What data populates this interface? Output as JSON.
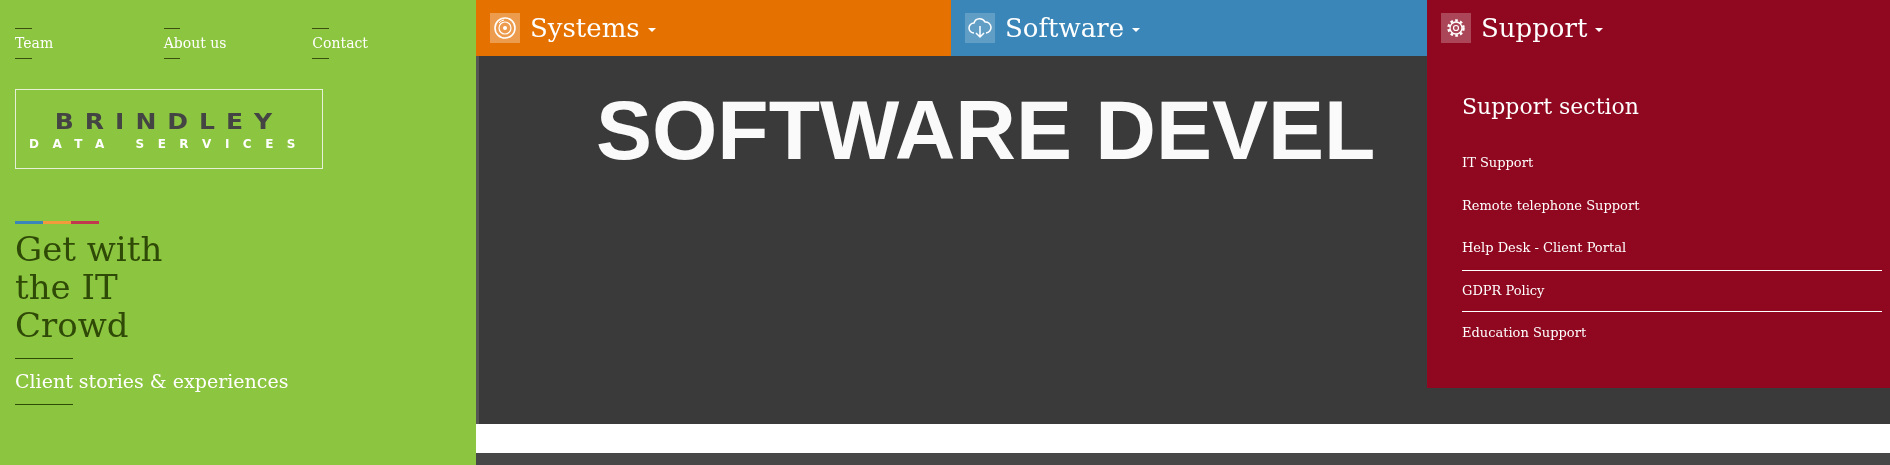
{
  "top_links": [
    {
      "label": "Team"
    },
    {
      "label": "About us"
    },
    {
      "label": "Contact"
    }
  ],
  "logo": {
    "name": "BRINDLEY",
    "tagline": "DATA SERVICES"
  },
  "headline": "Get with the IT Crowd",
  "client_link": "Client stories & experiences",
  "tabs": [
    {
      "label": "Systems",
      "kind": "systems",
      "color": "#e57200",
      "expanded": false
    },
    {
      "label": "Software",
      "kind": "software",
      "color": "#3a86b8",
      "expanded": false
    },
    {
      "label": "Support",
      "kind": "support",
      "color": "#8f0820",
      "expanded": true
    }
  ],
  "banner": {
    "title": "SOFTWARE DEVEL"
  },
  "dropdown": {
    "title": "Support section",
    "items": [
      {
        "label": "IT Support",
        "highlighted": false
      },
      {
        "label": "Remote telephone Support",
        "highlighted": false
      },
      {
        "label": "Help Desk - Client Portal",
        "highlighted": false
      },
      {
        "label": "GDPR Policy",
        "highlighted": true
      },
      {
        "label": "Education Support",
        "highlighted": false
      }
    ]
  }
}
